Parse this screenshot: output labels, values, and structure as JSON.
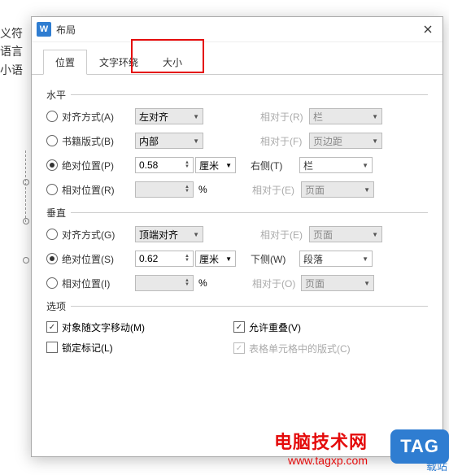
{
  "bg_lines": [
    "义符",
    "语言",
    "小语"
  ],
  "dialog": {
    "title": "布局",
    "app_icon": "W"
  },
  "tabs": [
    "位置",
    "文字环绕",
    "大小"
  ],
  "horizontal": {
    "header": "水平",
    "align": {
      "label": "对齐方式(A)",
      "value": "左对齐",
      "rel_label": "相对于(R)",
      "rel_value": "栏"
    },
    "book": {
      "label": "书籍版式(B)",
      "value": "内部",
      "rel_label": "相对于(F)",
      "rel_value": "页边距"
    },
    "abs": {
      "label": "绝对位置(P)",
      "value": "0.58",
      "unit": "厘米",
      "side_label": "右侧(T)",
      "rel_value": "栏"
    },
    "rel": {
      "label": "相对位置(R)",
      "value": "",
      "unit": "%",
      "rel_label": "相对于(E)",
      "rel_value": "页面"
    }
  },
  "vertical": {
    "header": "垂直",
    "align": {
      "label": "对齐方式(G)",
      "value": "顶端对齐",
      "rel_label": "相对于(E)",
      "rel_value": "页面"
    },
    "abs": {
      "label": "绝对位置(S)",
      "value": "0.62",
      "unit": "厘米",
      "side_label": "下侧(W)",
      "rel_value": "段落"
    },
    "rel": {
      "label": "相对位置(I)",
      "value": "",
      "unit": "%",
      "rel_label": "相对于(O)",
      "rel_value": "页面"
    }
  },
  "options": {
    "header": "选项",
    "move_with_text": "对象随文字移动(M)",
    "lock_anchor": "锁定标记(L)",
    "allow_overlap": "允许重叠(V)",
    "table_cell": "表格单元格中的版式(C)"
  },
  "watermark": {
    "name": "电脑技术网",
    "url": "www.tagxp.com",
    "badge": "TAG",
    "side": "载站"
  }
}
